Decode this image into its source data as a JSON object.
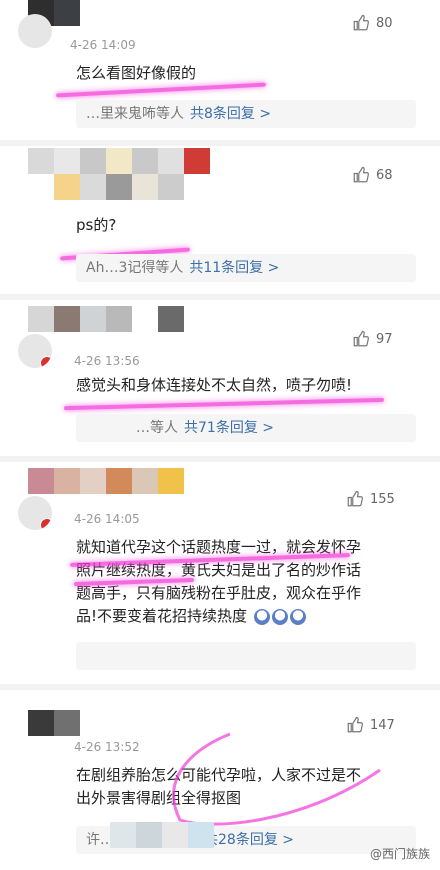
{
  "comments": [
    {
      "time": "4-26 14:09",
      "likes": "80",
      "text": "怎么看图好像假的",
      "reply_prefix": "…里来鬼咘等人",
      "reply_count": "共8条回复 >"
    },
    {
      "time": "",
      "likes": "68",
      "text": "ps的?",
      "reply_prefix": "Ah…3记得等人",
      "reply_count": "共11条回复 >"
    },
    {
      "time": "4-26 13:56",
      "likes": "97",
      "text": "感觉头和身体连接处不太自然，喷子勿喷!",
      "reply_prefix": "…等人",
      "reply_count": "共71条回复 >"
    },
    {
      "time": "4-26 14:05",
      "likes": "155",
      "text_lines": [
        "就知道代孕这个话题热度一过，就会发怀孕",
        "照片继续热度，黄氏夫妇是出了名的炒作话",
        "题高手，只有脑残粉在乎肚皮，观众在乎作",
        "品!不要变着花招持续热度"
      ],
      "reply_prefix": "",
      "reply_count": ""
    },
    {
      "time": "4-26 13:52",
      "likes": "147",
      "text_lines": [
        "在剧组养胎怎么可能代孕啦，人家不过是不",
        "出外景害得剧组全得抠图"
      ],
      "reply_prefix": "许…",
      "reply_count": "共28条回复 >"
    }
  ],
  "watermark": "@西门族族",
  "colors": {
    "highlight": "#f23bd8",
    "link": "#3d6fa8"
  }
}
